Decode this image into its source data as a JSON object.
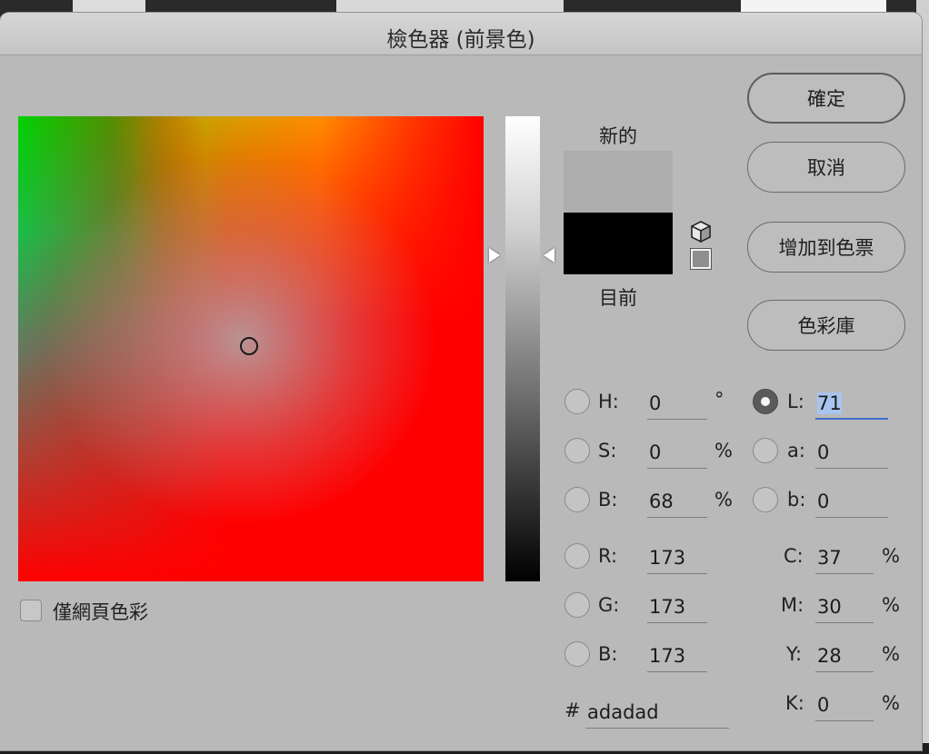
{
  "title": "檢色器 (前景色)",
  "swatches": {
    "new_label": "新的",
    "current_label": "目前",
    "new_color": "#adadad",
    "current_color": "#000000"
  },
  "buttons": {
    "ok": "確定",
    "cancel": "取消",
    "add_to_swatches": "增加到色票",
    "color_libraries": "色彩庫"
  },
  "hsb": {
    "h_label": "H:",
    "h_value": "0",
    "h_unit": "°",
    "s_label": "S:",
    "s_value": "0",
    "s_unit": "%",
    "b_label": "B:",
    "b_value": "68",
    "b_unit": "%"
  },
  "rgb": {
    "r_label": "R:",
    "r_value": "173",
    "g_label": "G:",
    "g_value": "173",
    "b_label": "B:",
    "b_value": "173"
  },
  "lab": {
    "l_label": "L:",
    "l_value": "71",
    "a_label": "a:",
    "a_value": "0",
    "b_label": "b:",
    "b_value": "0",
    "selected": "L"
  },
  "cmyk": {
    "c_label": "C:",
    "c_value": "37",
    "m_label": "M:",
    "m_value": "30",
    "y_label": "Y:",
    "y_value": "28",
    "k_label": "K:",
    "k_value": "0",
    "unit": "%"
  },
  "hex": {
    "label": "#",
    "value": "adadad"
  },
  "web_only": {
    "label": "僅網頁色彩",
    "checked": false
  }
}
